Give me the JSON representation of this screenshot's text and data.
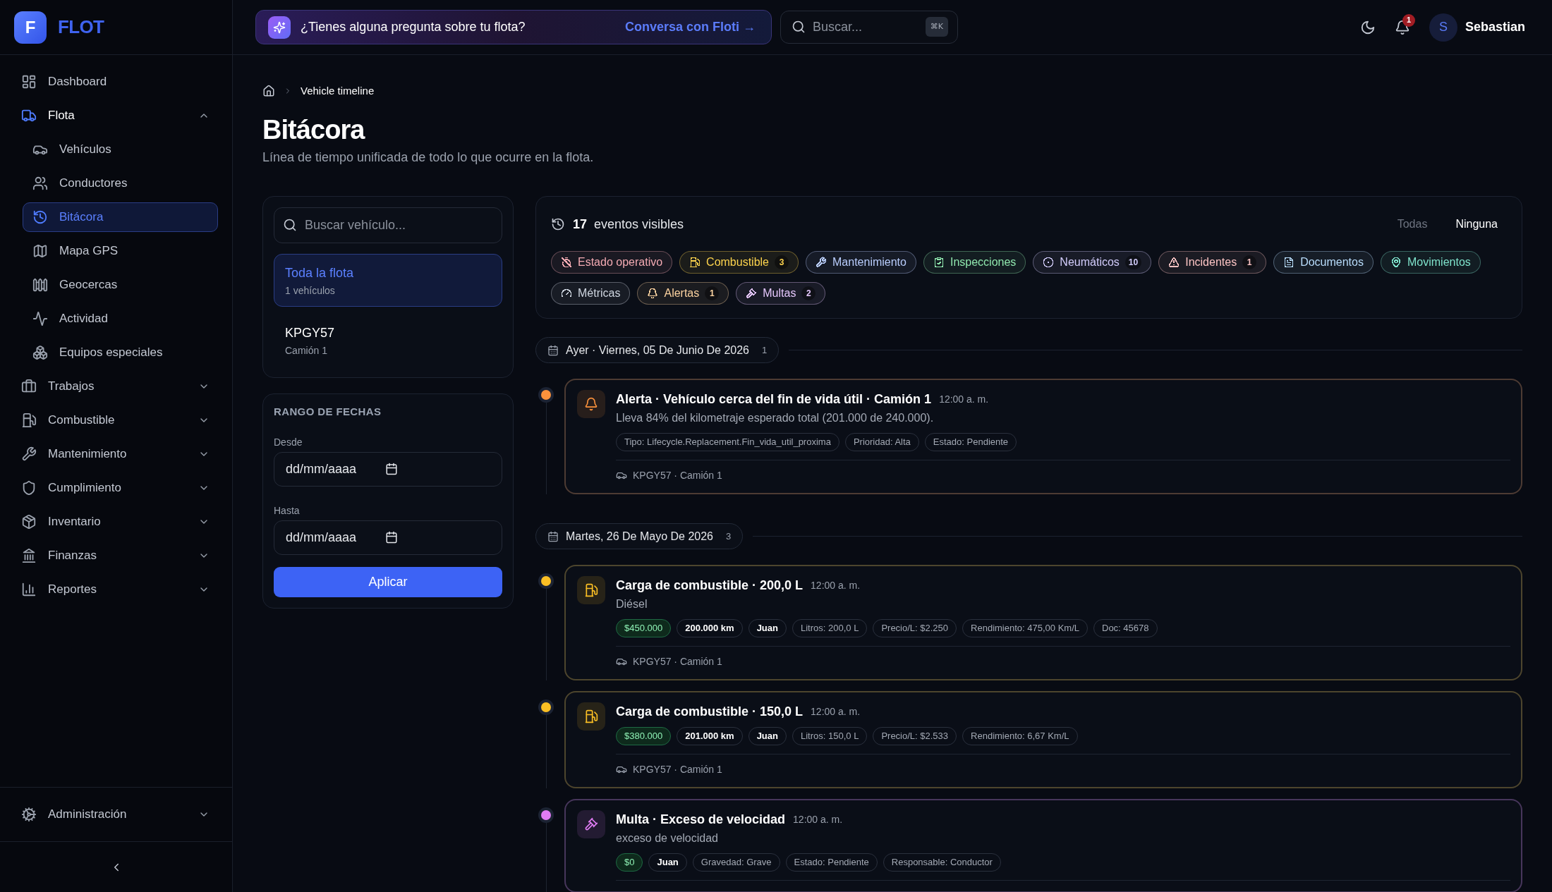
{
  "sidebar": {
    "brand": {
      "initial": "F",
      "name": "FLOT"
    },
    "items": [
      {
        "label": "Dashboard",
        "selected": false
      },
      {
        "label": "Flota",
        "selected": false,
        "expanded": true,
        "children": [
          {
            "label": "Vehículos",
            "selected": false
          },
          {
            "label": "Conductores",
            "selected": false
          },
          {
            "label": "Bitácora",
            "selected": true
          },
          {
            "label": "Mapa GPS",
            "selected": false
          },
          {
            "label": "Geocercas",
            "selected": false
          },
          {
            "label": "Actividad",
            "selected": false
          },
          {
            "label": "Equipos especiales",
            "selected": false
          }
        ]
      },
      {
        "label": "Trabajos",
        "selected": false,
        "expanded": false
      },
      {
        "label": "Combustible",
        "selected": false,
        "expanded": false
      },
      {
        "label": "Mantenimiento",
        "selected": false,
        "expanded": false
      },
      {
        "label": "Cumplimiento",
        "selected": false,
        "expanded": false
      },
      {
        "label": "Inventario",
        "selected": false,
        "expanded": false
      },
      {
        "label": "Finanzas",
        "selected": false,
        "expanded": false
      },
      {
        "label": "Reportes",
        "selected": false,
        "expanded": false
      }
    ],
    "footer_item": {
      "label": "Administración",
      "selected": false,
      "expanded": false
    }
  },
  "topbar": {
    "assistant_banner": {
      "text": "¿Tienes alguna pregunta sobre tu flota?",
      "link": "Conversa con Floti →"
    },
    "search": {
      "placeholder": "Buscar...",
      "shortcut": "⌘K"
    },
    "notifications": {
      "badge": "1"
    },
    "user": {
      "initial": "S",
      "name": "Sebastian"
    }
  },
  "breadcrumb": [
    "Vehicle timeline"
  ],
  "page": {
    "title": "Bitácora",
    "subtitle": "Línea de tiempo unificada de todo lo que ocurre en la flota."
  },
  "vehicle_panel": {
    "search": {
      "placeholder": "Buscar vehículo..."
    },
    "items": [
      {
        "title": "Toda la flota",
        "subtitle": "1 vehículos",
        "selected": true
      },
      {
        "title": "KPGY57",
        "subtitle": "Camión 1",
        "selected": false
      }
    ]
  },
  "date_range": {
    "heading": "RANGO DE FECHAS",
    "fields": [
      {
        "label": "Desde",
        "placeholder": "dd/mm/aaaa"
      },
      {
        "label": "Hasta",
        "placeholder": "dd/mm/aaaa"
      }
    ],
    "button": "Aplicar"
  },
  "filters": {
    "count": "17",
    "label": "eventos visibles",
    "actions": [
      {
        "label": "Todas",
        "disabled": true
      },
      {
        "label": "Ninguna",
        "disabled": false
      }
    ],
    "chips": [
      {
        "label": "Estado operativo",
        "color": "#f3aab2",
        "selected": true
      },
      {
        "label": "Combustible",
        "count": "3",
        "color": "#fcd34d",
        "selected": true
      },
      {
        "label": "Mantenimiento",
        "color": "#b9cdfd",
        "selected": true
      },
      {
        "label": "Inspecciones",
        "color": "#8fe6ad",
        "selected": true
      },
      {
        "label": "Neumáticos",
        "count": "10",
        "color": "#d3cdfc",
        "selected": true
      },
      {
        "label": "Incidentes",
        "count": "1",
        "color": "#fbc3c3",
        "selected": true
      },
      {
        "label": "Documentos",
        "color": "#b8dcfb",
        "selected": true
      },
      {
        "label": "Movimientos",
        "color": "#7fe3cc",
        "selected": true
      },
      {
        "label": "Métricas",
        "color": "#cfd6e0",
        "selected": true
      },
      {
        "label": "Alertas",
        "count": "1",
        "color": "#fcd3a0",
        "selected": true
      },
      {
        "label": "Multas",
        "count": "2",
        "color": "#e4c6fb",
        "selected": true
      }
    ]
  },
  "timeline": [
    {
      "date": "Ayer · Viernes, 05 De Junio De 2026",
      "count": "1",
      "events": [
        {
          "kind": "alert",
          "color": "#fb923c",
          "title": "Alerta · Vehículo cerca del fin de vida útil · Camión 1",
          "time": "12:00 a. m.",
          "description": "Lleva 84% del kilometraje esperado total (201.000 de 240.000).",
          "tags": [
            {
              "kind": "detail",
              "text": "Tipo: Lifecycle.Replacement.Fin_vida_util_proxima"
            },
            {
              "kind": "detail",
              "text": "Prioridad: Alta"
            },
            {
              "kind": "detail",
              "text": "Estado: Pendiente"
            }
          ],
          "vehicle": "KPGY57 · Camión 1"
        }
      ]
    },
    {
      "date": "Martes, 26 De Mayo De 2026",
      "count": "3",
      "events": [
        {
          "kind": "fuel",
          "color": "#fbbf24",
          "title": "Carga de combustible · 200,0 L",
          "time": "12:00 a. m.",
          "description": "Diésel",
          "tags": [
            {
              "kind": "amount",
              "text": "$450.000"
            },
            {
              "kind": "strong",
              "text": "200.000 km"
            },
            {
              "kind": "strong",
              "text": "Juan"
            },
            {
              "kind": "detail",
              "text": "Litros: 200,0 L"
            },
            {
              "kind": "detail",
              "text": "Precio/L: $2.250"
            },
            {
              "kind": "detail",
              "text": "Rendimiento: 475,00 Km/L"
            },
            {
              "kind": "detail",
              "text": "Doc: 45678"
            }
          ],
          "vehicle": "KPGY57 · Camión 1"
        },
        {
          "kind": "fuel",
          "color": "#fbbf24",
          "title": "Carga de combustible · 150,0 L",
          "time": "12:00 a. m.",
          "tags": [
            {
              "kind": "amount",
              "text": "$380.000"
            },
            {
              "kind": "strong",
              "text": "201.000 km"
            },
            {
              "kind": "strong",
              "text": "Juan"
            },
            {
              "kind": "detail",
              "text": "Litros: 150,0 L"
            },
            {
              "kind": "detail",
              "text": "Precio/L: $2.533"
            },
            {
              "kind": "detail",
              "text": "Rendimiento: 6,67 Km/L"
            }
          ],
          "vehicle": "KPGY57 · Camión 1"
        },
        {
          "kind": "fine",
          "color": "#e07cf4",
          "title": "Multa · Exceso de velocidad",
          "time": "12:00 a. m.",
          "description": "exceso de velocidad",
          "tags": [
            {
              "kind": "amount",
              "text": "$0"
            },
            {
              "kind": "strong",
              "text": "Juan"
            },
            {
              "kind": "detail",
              "text": "Gravedad: Grave"
            },
            {
              "kind": "detail",
              "text": "Estado: Pendiente"
            },
            {
              "kind": "detail",
              "text": "Responsable: Conductor"
            }
          ]
        }
      ]
    }
  ]
}
